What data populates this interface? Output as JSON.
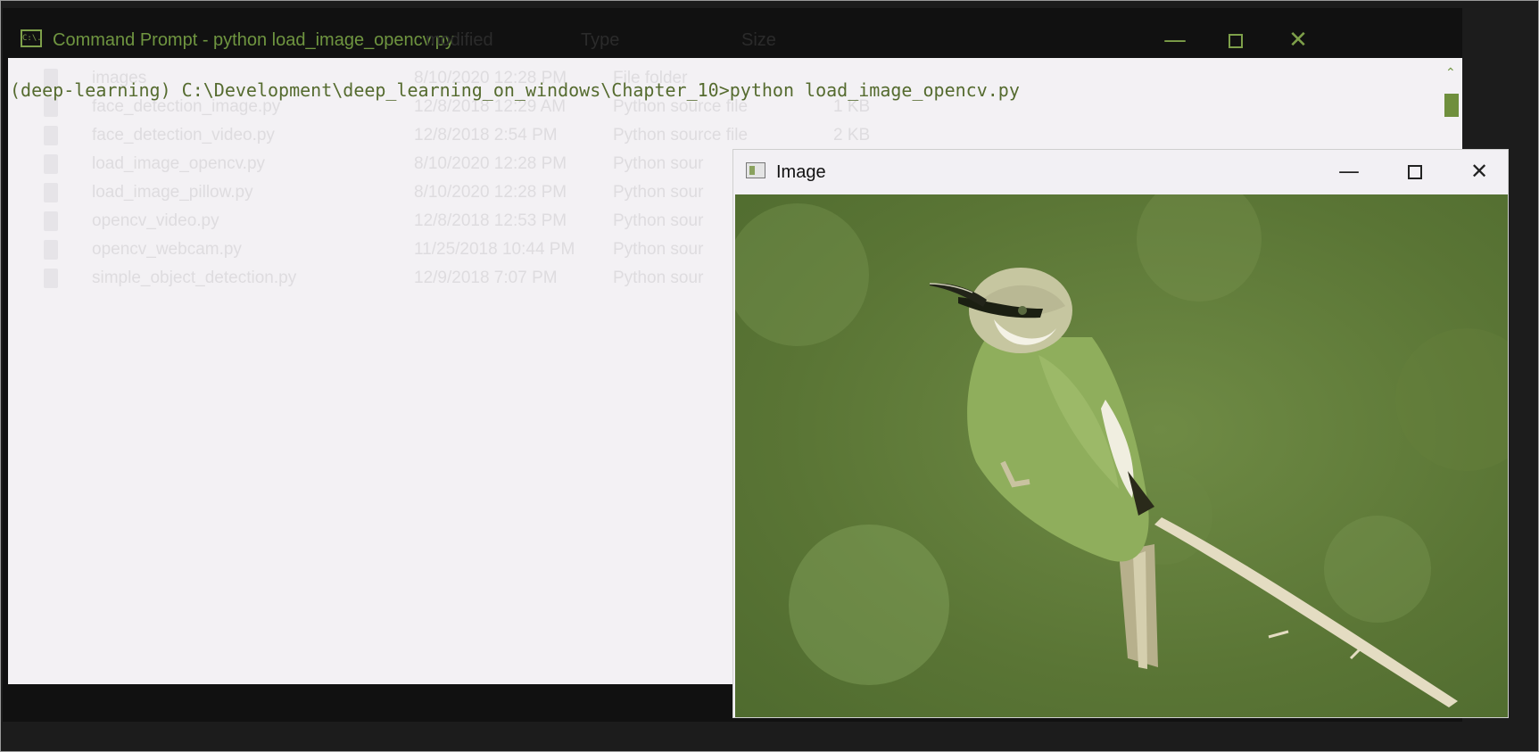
{
  "cmd": {
    "title": "Command Prompt - python  load_image_opencv.py",
    "icon_label": "C:\\.",
    "ghost_headers": [
      "modified",
      "Type",
      "Size"
    ],
    "minimize_glyph": "—",
    "close_glyph": "✕",
    "scroll_up_glyph": "⌃",
    "command_line": "(deep-learning) C:\\Development\\deep_learning_on_windows\\Chapter_10>python load_image_opencv.py"
  },
  "explorer_ghost_rows": [
    {
      "name": "images",
      "date": "8/10/2020 12:28 PM",
      "type": "File folder",
      "size": ""
    },
    {
      "name": "face_detection_image.py",
      "date": "12/8/2018 12:29 AM",
      "type": "Python source file",
      "size": "1 KB"
    },
    {
      "name": "face_detection_video.py",
      "date": "12/8/2018 2:54 PM",
      "type": "Python source file",
      "size": "2 KB"
    },
    {
      "name": "load_image_opencv.py",
      "date": "8/10/2020 12:28 PM",
      "type": "Python sour",
      "size": ""
    },
    {
      "name": "load_image_pillow.py",
      "date": "8/10/2020 12:28 PM",
      "type": "Python sour",
      "size": ""
    },
    {
      "name": "opencv_video.py",
      "date": "12/8/2018 12:53 PM",
      "type": "Python sour",
      "size": ""
    },
    {
      "name": "opencv_webcam.py",
      "date": "11/25/2018 10:44 PM",
      "type": "Python sour",
      "size": ""
    },
    {
      "name": "simple_object_detection.py",
      "date": "12/9/2018 7:07 PM",
      "type": "Python sour",
      "size": ""
    }
  ],
  "image_window": {
    "title": "Image",
    "minimize_glyph": "—",
    "close_glyph": "✕"
  },
  "colors": {
    "terminal_green": "#556b2f",
    "title_green": "#6f9540",
    "image_background": "#5e7a39",
    "bird_body": "#8fae5c"
  },
  "icons": [
    "command-prompt-icon",
    "minimize-icon",
    "maximize-icon",
    "close-icon",
    "scroll-up-icon",
    "image-window-icon",
    "file-icon",
    "folder-icon"
  ]
}
